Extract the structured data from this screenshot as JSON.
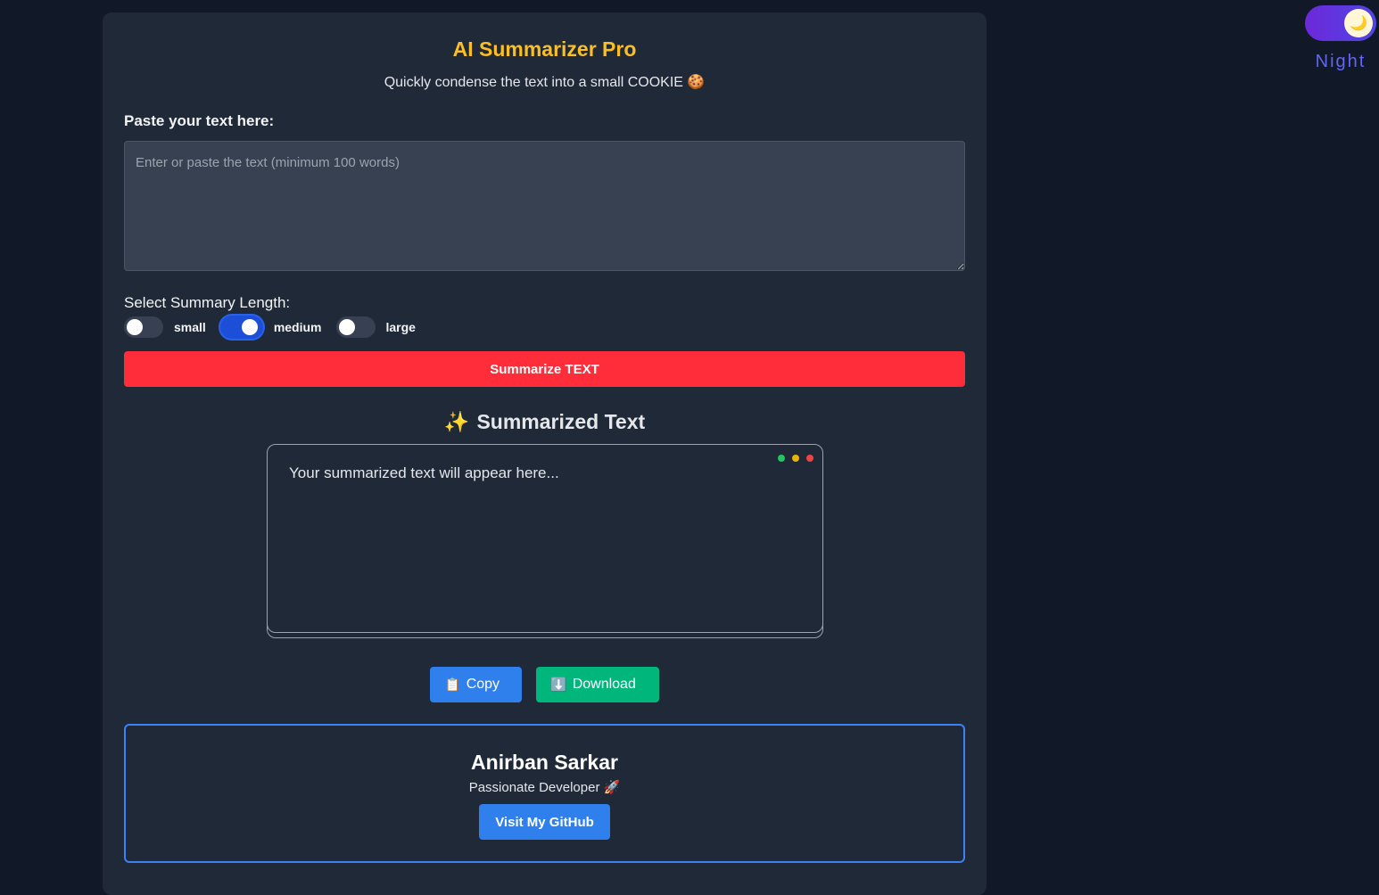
{
  "app": {
    "title": "AI Summarizer Pro",
    "subtitle": "Quickly condense the text into a small COOKIE 🍪"
  },
  "input": {
    "label": "Paste your text here:",
    "placeholder": "Enter or paste the text (minimum 100 words)",
    "value": ""
  },
  "length": {
    "label": "Select Summary Length:",
    "options": [
      {
        "label": "small",
        "selected": false
      },
      {
        "label": "medium",
        "selected": true
      },
      {
        "label": "large",
        "selected": false
      }
    ]
  },
  "actions": {
    "summarize_label": "Summarize TEXT",
    "copy_label": "Copy",
    "copy_icon": "📋",
    "download_label": "Download",
    "download_icon": "⬇️"
  },
  "output": {
    "title": "Summarized Text",
    "title_icon": "✨",
    "placeholder": "Your summarized text will appear here...",
    "dot_colors": [
      "#22c55e",
      "#eab308",
      "#ef4444"
    ]
  },
  "profile": {
    "name": "Anirban Sarkar",
    "role": "Passionate Developer 🚀",
    "github_label": "Visit My GitHub"
  },
  "theme": {
    "mode_label": "Night",
    "mode_icon": "🌙",
    "dark_mode": true
  },
  "colors": {
    "accent_title": "#fbbf24",
    "summarize_button": "#ff2d3a",
    "primary_button": "#2f80ed",
    "download_button": "#00b67a"
  }
}
